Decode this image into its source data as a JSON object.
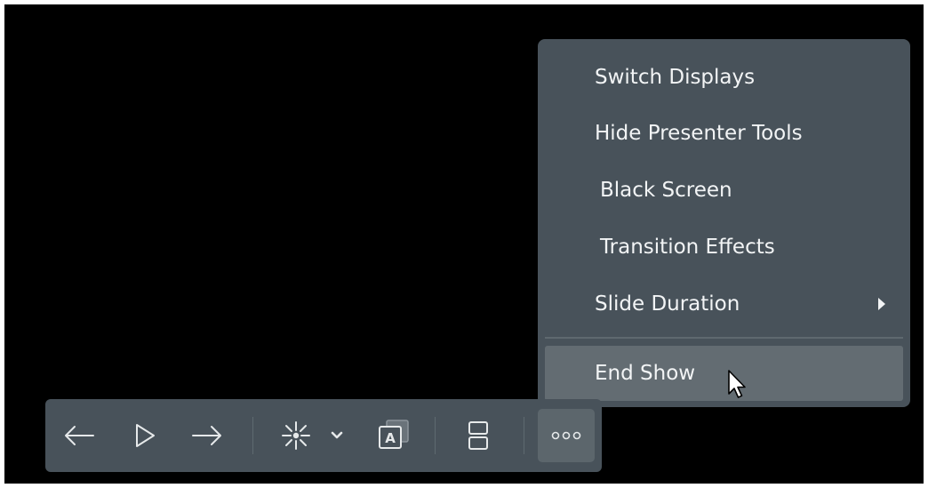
{
  "menu": {
    "items": [
      {
        "label": "Switch Displays"
      },
      {
        "label": "Hide Presenter Tools"
      },
      {
        "label": "Black Screen"
      },
      {
        "label": "Transition Effects"
      },
      {
        "label": "Slide Duration",
        "has_submenu": true
      },
      {
        "label": "End Show",
        "hovered": true
      }
    ]
  },
  "toolbar": {
    "buttons": [
      {
        "icon": "arrow-left-icon"
      },
      {
        "icon": "play-icon"
      },
      {
        "icon": "arrow-right-icon"
      },
      {
        "icon": "laser-pointer-icon"
      },
      {
        "icon": "chevron-down-icon"
      },
      {
        "icon": "subtitles-icon"
      },
      {
        "icon": "presenter-layout-icon"
      },
      {
        "icon": "more-options-icon",
        "active": true
      }
    ]
  },
  "colors": {
    "background": "#000000",
    "panel": "#48525a",
    "hover": "#636c72",
    "text": "#f2f4f5"
  }
}
